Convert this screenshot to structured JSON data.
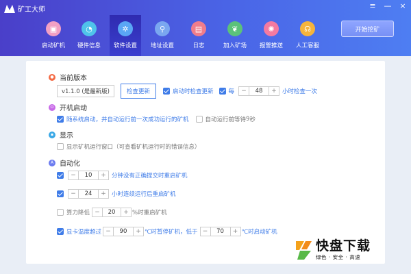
{
  "app": {
    "title": "矿工大师",
    "win_controls": [
      "≡",
      "—",
      "×"
    ]
  },
  "nav": {
    "items": [
      {
        "label": "启动矿机",
        "icon": "monitor-icon",
        "color": "#f2a0c4",
        "active": false
      },
      {
        "label": "硬件信息",
        "icon": "gauge-icon",
        "color": "#4fc3ea",
        "active": false
      },
      {
        "label": "软件设置",
        "icon": "gear-icon",
        "color": "#5aa6f5",
        "active": true
      },
      {
        "label": "地址设置",
        "icon": "location-icon",
        "color": "#7aa7f0",
        "active": false
      },
      {
        "label": "日志",
        "icon": "document-icon",
        "color": "#f07d8b",
        "active": false
      },
      {
        "label": "加入矿场",
        "icon": "plant-icon",
        "color": "#5bc27a",
        "active": false
      },
      {
        "label": "报警推送",
        "icon": "alarm-icon",
        "color": "#f47aa0",
        "active": false
      },
      {
        "label": "人工客服",
        "icon": "headset-icon",
        "color": "#f5b43c",
        "active": false
      }
    ],
    "start_label": "开始挖矿"
  },
  "version": {
    "title": "当前版本",
    "icon_color": "#f46b45",
    "current": "v1.1.0 (是最新版)",
    "check_btn": "检查更新",
    "check_on_start": {
      "label": "启动时检查更新",
      "checked": true
    },
    "every": {
      "label": "每",
      "checked": true,
      "value": "48",
      "suffix": "小时检查一次"
    }
  },
  "boot": {
    "title": "开机启动",
    "icon_color": "#c86ae8",
    "auto_start": {
      "label": "随系统启动，并自动运行前一次成功运行的矿机",
      "checked": true
    },
    "wait": {
      "label": "自动运行前等待",
      "value": "9",
      "suffix": "秒",
      "checked": false
    }
  },
  "display": {
    "title": "显示",
    "icon_color": "#3aa8e6",
    "show_window": {
      "label": "显示矿机运行窗口（可查看矿机运行时的错误信息）",
      "checked": false
    }
  },
  "automation": {
    "title": "自动化",
    "icon_color": "#6c7cf0",
    "restart_no_submit": {
      "checked": true,
      "value": "10",
      "suffix": "分钟没有正确提交时重启矿机"
    },
    "restart_hours": {
      "checked": true,
      "value": "24",
      "suffix": "小时连续运行后重启矿机"
    },
    "hashrate_drop": {
      "checked": false,
      "prefix": "算力降低",
      "value": "20",
      "suffix": "%时重启矿机"
    },
    "temp": {
      "checked": true,
      "prefix": "显卡温度超过",
      "value1": "90",
      "middle": "℃时暂停矿机，低于",
      "value2": "70",
      "suffix": "℃时启动矿机"
    }
  },
  "watermark": {
    "title": "快盘下载",
    "subtitle": "绿色 · 安全 · 高速"
  }
}
